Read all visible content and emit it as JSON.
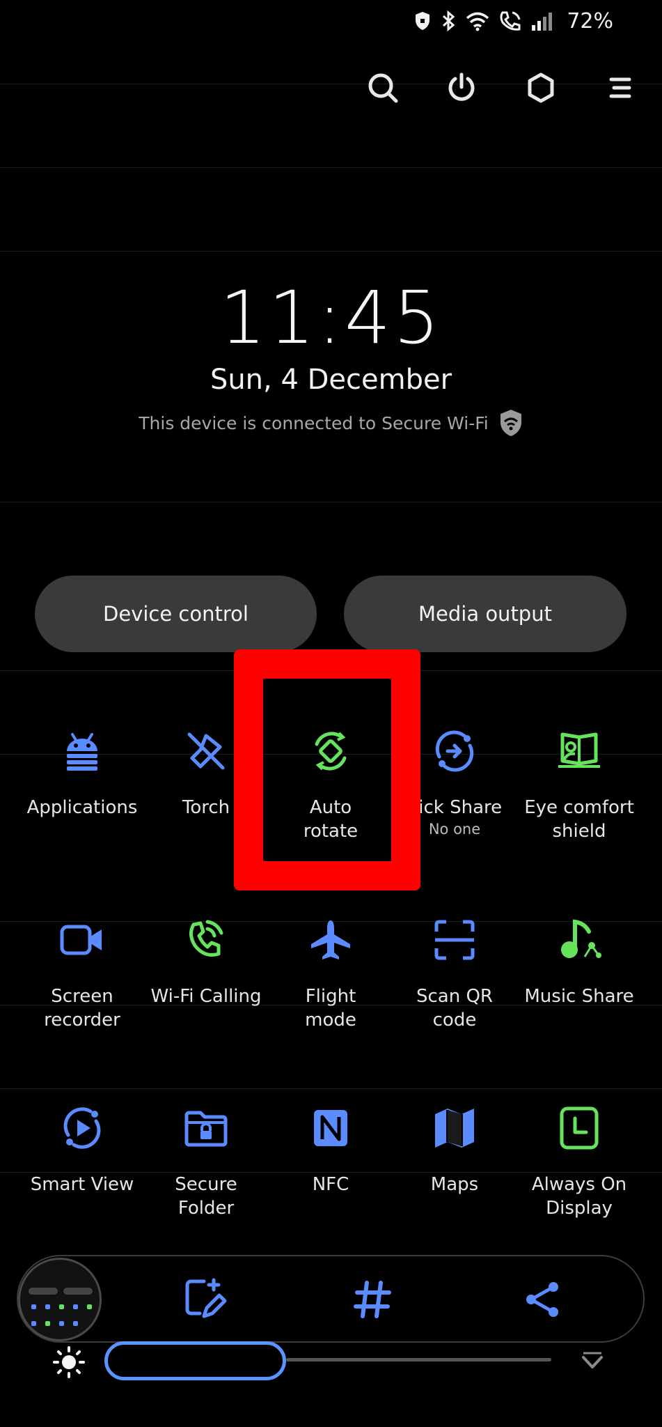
{
  "status_bar": {
    "battery": "72%"
  },
  "clock": {
    "time": "11:45",
    "date": "Sun, 4 December",
    "wifi_message": "This device is connected to Secure Wi-Fi"
  },
  "pills": {
    "device_control": "Device control",
    "media_output": "Media output"
  },
  "tiles": [
    {
      "label": "Applications",
      "color": "#5b8cff"
    },
    {
      "label": "Torch",
      "color": "#5b8cff"
    },
    {
      "label": "Auto\nrotate",
      "color": "#66e35c"
    },
    {
      "label": "uick Share",
      "sub": "No one",
      "color": "#5b8cff"
    },
    {
      "label": "Eye comfort\nshield",
      "color": "#66e35c"
    },
    {
      "label": "Screen\nrecorder",
      "color": "#5b8cff"
    },
    {
      "label": "Wi-Fi Calling",
      "color": "#66e35c"
    },
    {
      "label": "Flight\nmode",
      "color": "#5b8cff"
    },
    {
      "label": "Scan QR\ncode",
      "color": "#5b8cff"
    },
    {
      "label": "Music Share",
      "color": "#66e35c"
    },
    {
      "label": "Smart View",
      "color": "#5b8cff"
    },
    {
      "label": "Secure\nFolder",
      "color": "#5b8cff"
    },
    {
      "label": "NFC",
      "color": "#5b8cff"
    },
    {
      "label": "Maps",
      "color": "#5b8cff"
    },
    {
      "label": "Always On\nDisplay",
      "color": "#66e35c"
    }
  ],
  "brightness": {
    "level_fraction": 0.32
  },
  "colors": {
    "accent_blue": "#5b8cff",
    "accent_green": "#66e35c",
    "highlight": "#ff0000"
  },
  "icons": [
    "search-icon",
    "power-icon",
    "settings-icon",
    "menu-icon",
    "shield-icon",
    "android-icon",
    "torch-icon",
    "auto-rotate-icon",
    "quick-share-icon",
    "eye-comfort-icon",
    "screen-recorder-icon",
    "wifi-calling-icon",
    "flight-mode-icon",
    "qr-scan-icon",
    "music-share-icon",
    "smart-view-icon",
    "secure-folder-icon",
    "nfc-icon",
    "maps-icon",
    "always-on-display-icon",
    "edit-icon",
    "hashtag-icon",
    "share-icon",
    "sun-icon",
    "chevron-down-icon"
  ]
}
